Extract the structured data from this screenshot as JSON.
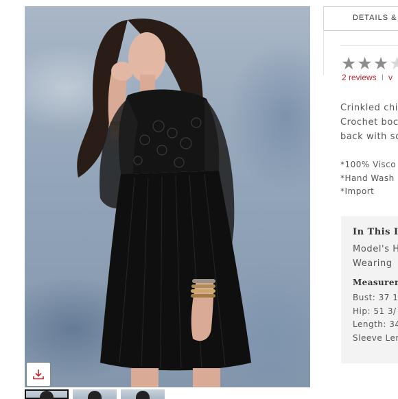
{
  "tabs": {
    "details_label": "DETAILS &"
  },
  "rating": {
    "stars_filled": 3,
    "stars_total": 5,
    "reviews_link": "2 reviews",
    "separator": "I",
    "write_link": "v"
  },
  "description": {
    "lines": [
      "Crinkled chi",
      "Crochet boc",
      "back with sc"
    ]
  },
  "care": {
    "lines": [
      "*100% Visco",
      "*Hand Wash",
      "*Import"
    ]
  },
  "fit": {
    "title": "In This I",
    "lines": [
      "Model's H",
      "Wearing"
    ],
    "measurements_title": "Measurem",
    "measurements": [
      "Bust: 37 1",
      "Hip: 51 3/",
      "Length: 34",
      "Sleeve Ler"
    ]
  },
  "gallery": {
    "thumbnail_count": 3,
    "active_index": 0,
    "download_icon": "download-icon"
  },
  "colors": {
    "accent_red": "#c0272d",
    "star_gray": "#8d8d8d",
    "fit_box_bg": "#f3f3f3"
  }
}
